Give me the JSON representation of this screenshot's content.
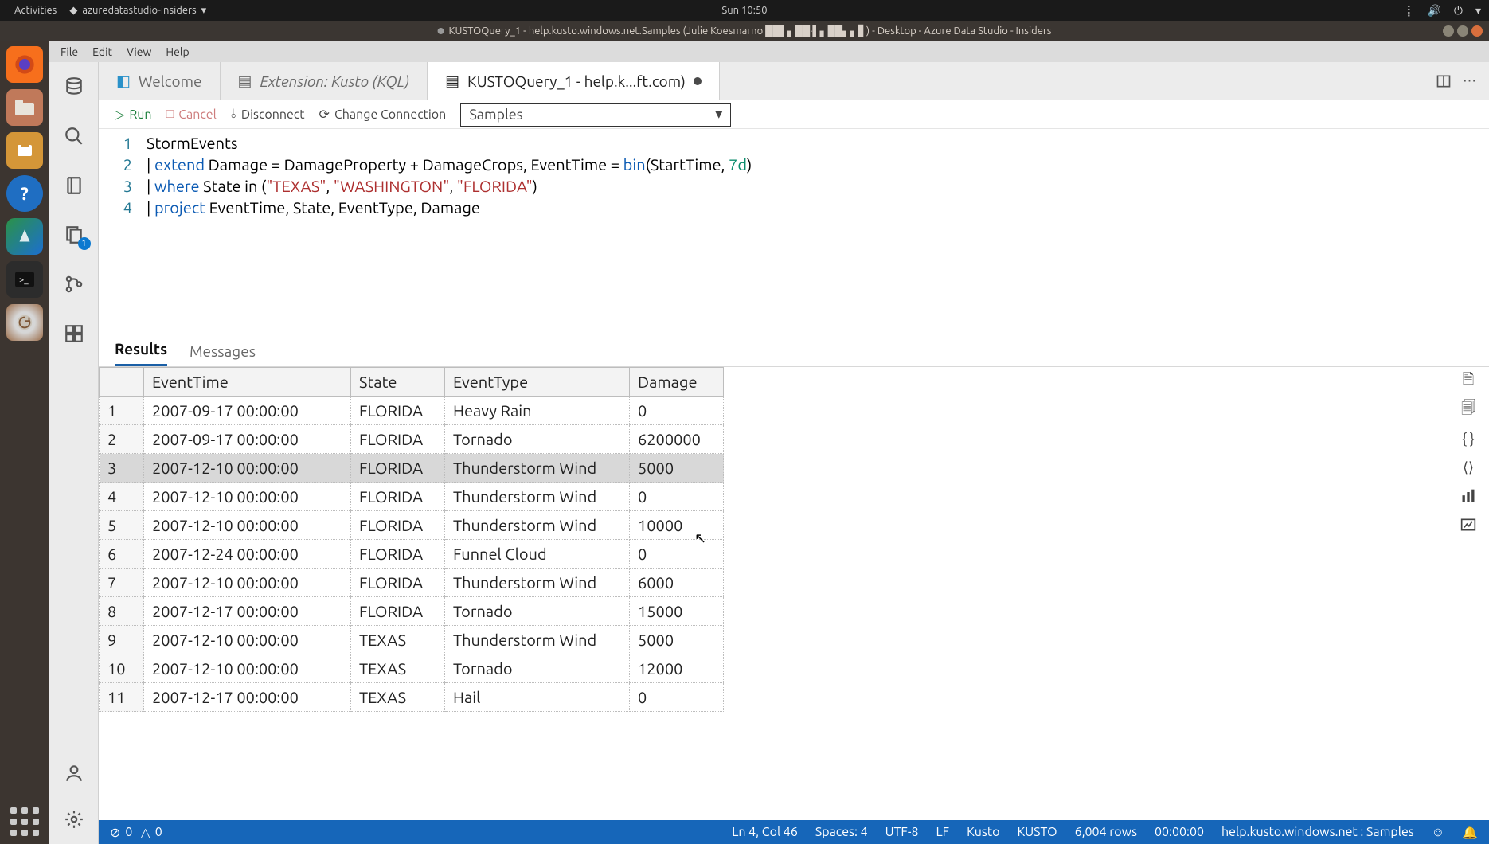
{
  "gnome": {
    "activities": "Activities",
    "app_indicator": "azuredatastudio-insiders",
    "clock": "Sun 10:50"
  },
  "window": {
    "title": "KUSTOQuery_1 - help.kusto.windows.net.Samples (Julie Koesmarno ██▌▖██·▌▖██▖▖▋) - Desktop - Azure Data Studio - Insiders"
  },
  "menubar": [
    "File",
    "Edit",
    "View",
    "Help"
  ],
  "activity_badge": "1",
  "tabs": {
    "welcome": "Welcome",
    "extension": "Extension: Kusto (KQL)",
    "query": "KUSTOQuery_1 - help.k...ft.com)"
  },
  "query_toolbar": {
    "run": "Run",
    "cancel": "Cancel",
    "disconnect": "Disconnect",
    "change_connection": "Change Connection",
    "database": "Samples"
  },
  "editor": {
    "lines": [
      "1",
      "2",
      "3",
      "4"
    ],
    "l1": "StormEvents",
    "l2a": "| ",
    "l2b": "extend",
    "l2c": " Damage = DamageProperty + DamageCrops, EventTime = ",
    "l2d": "bin",
    "l2e": "(StartTime, ",
    "l2f": "7d",
    "l2g": ")",
    "l3a": "| ",
    "l3b": "where",
    "l3c": " State in (",
    "l3d": "\"TEXAS\"",
    "l3e": ", ",
    "l3f": "\"WASHINGTON\"",
    "l3g": ", ",
    "l3h": "\"FLORIDA\"",
    "l3i": ")",
    "l4a": "| ",
    "l4b": "project",
    "l4c": " EventTime, State, EventType, Damage"
  },
  "results": {
    "tabs": {
      "results": "Results",
      "messages": "Messages"
    },
    "columns": [
      "EventTime",
      "State",
      "EventType",
      "Damage"
    ],
    "rows": [
      {
        "n": "1",
        "EventTime": "2007-09-17 00:00:00",
        "State": "FLORIDA",
        "EventType": "Heavy Rain",
        "Damage": "0"
      },
      {
        "n": "2",
        "EventTime": "2007-09-17 00:00:00",
        "State": "FLORIDA",
        "EventType": "Tornado",
        "Damage": "6200000"
      },
      {
        "n": "3",
        "EventTime": "2007-12-10 00:00:00",
        "State": "FLORIDA",
        "EventType": "Thunderstorm Wind",
        "Damage": "5000"
      },
      {
        "n": "4",
        "EventTime": "2007-12-10 00:00:00",
        "State": "FLORIDA",
        "EventType": "Thunderstorm Wind",
        "Damage": "0"
      },
      {
        "n": "5",
        "EventTime": "2007-12-10 00:00:00",
        "State": "FLORIDA",
        "EventType": "Thunderstorm Wind",
        "Damage": "10000"
      },
      {
        "n": "6",
        "EventTime": "2007-12-24 00:00:00",
        "State": "FLORIDA",
        "EventType": "Funnel Cloud",
        "Damage": "0"
      },
      {
        "n": "7",
        "EventTime": "2007-12-10 00:00:00",
        "State": "FLORIDA",
        "EventType": "Thunderstorm Wind",
        "Damage": "6000"
      },
      {
        "n": "8",
        "EventTime": "2007-12-17 00:00:00",
        "State": "FLORIDA",
        "EventType": "Tornado",
        "Damage": "15000"
      },
      {
        "n": "9",
        "EventTime": "2007-12-10 00:00:00",
        "State": "TEXAS",
        "EventType": "Thunderstorm Wind",
        "Damage": "5000"
      },
      {
        "n": "10",
        "EventTime": "2007-12-10 00:00:00",
        "State": "TEXAS",
        "EventType": "Tornado",
        "Damage": "12000"
      },
      {
        "n": "11",
        "EventTime": "2007-12-17 00:00:00",
        "State": "TEXAS",
        "EventType": "Hail",
        "Damage": "0"
      }
    ],
    "selected_row_index": 2
  },
  "statusbar": {
    "errors": "0",
    "warnings": "0",
    "cursor": "Ln 4, Col 46",
    "spaces": "Spaces: 4",
    "encoding": "UTF-8",
    "eol": "LF",
    "lang": "Kusto",
    "engine": "KUSTO",
    "rows": "6,004 rows",
    "elapsed": "00:00:00",
    "connection": "help.kusto.windows.net : Samples"
  }
}
